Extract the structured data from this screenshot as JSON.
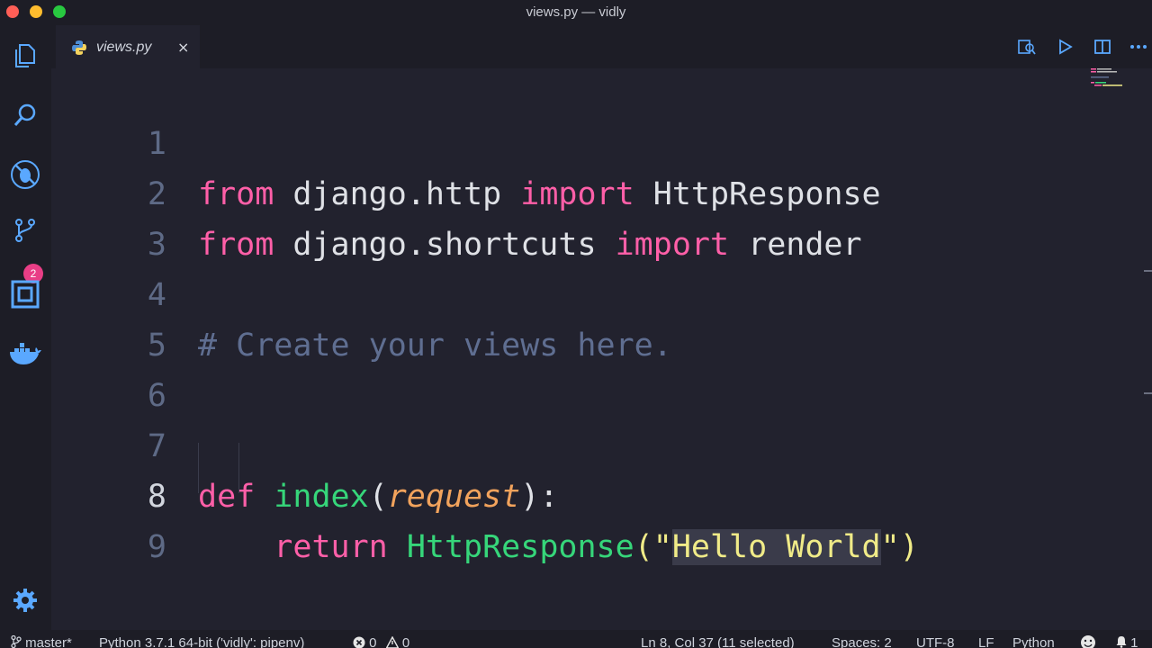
{
  "window": {
    "title": "views.py — vidly"
  },
  "activity_bar": {
    "items": [
      "explorer-icon",
      "search-icon",
      "debug-icon",
      "source-control-icon",
      "extensions-icon",
      "docker-icon"
    ],
    "source_control_badge": "2",
    "settings": "gear-icon"
  },
  "tabs": [
    {
      "label": "views.py",
      "active": true,
      "close": "×"
    }
  ],
  "editor": {
    "language": "python",
    "lines": [
      {
        "n": "1",
        "text": "from django.http import HttpResponse"
      },
      {
        "n": "2",
        "text": "from django.shortcuts import render"
      },
      {
        "n": "3",
        "text": ""
      },
      {
        "n": "4",
        "text": "# Create your views here."
      },
      {
        "n": "5",
        "text": ""
      },
      {
        "n": "6",
        "text": ""
      },
      {
        "n": "7",
        "text": "def index(request):"
      },
      {
        "n": "8",
        "text": "    return HttpResponse(\"Hello World\")"
      },
      {
        "n": "9",
        "text": ""
      }
    ],
    "tokens": {
      "from": "from",
      "import": "import",
      "def": "def",
      "return": "return",
      "mod1": "django.http",
      "cls1": "HttpResponse",
      "mod2": "django.shortcuts",
      "fn_render": "render",
      "comment": "# Create your views here.",
      "fn_index": "index",
      "open_paren": "(",
      "param": "request",
      "close_colon": "):",
      "call_cls": "HttpResponse",
      "call_open": "(\"",
      "string_sel": "Hello World",
      "call_close": "\")"
    },
    "current_line": "8",
    "selected_text": "Hello World"
  },
  "status_bar": {
    "branch": "master*",
    "interpreter": "Python 3.7.1 64-bit ('vidly': pipenv)",
    "errors": "0",
    "warnings": "0",
    "cursor": "Ln 8, Col 37 (11 selected)",
    "spaces": "Spaces: 2",
    "encoding": "UTF-8",
    "eol": "LF",
    "language": "Python",
    "notifications": "1"
  },
  "colors": {
    "background": "#22222e",
    "keyword": "#ff5fa8",
    "comment": "#5f6e91",
    "function": "#36d67a",
    "parameter": "#f2a35c",
    "string": "#f0eb88",
    "badge": "#e93e86"
  }
}
